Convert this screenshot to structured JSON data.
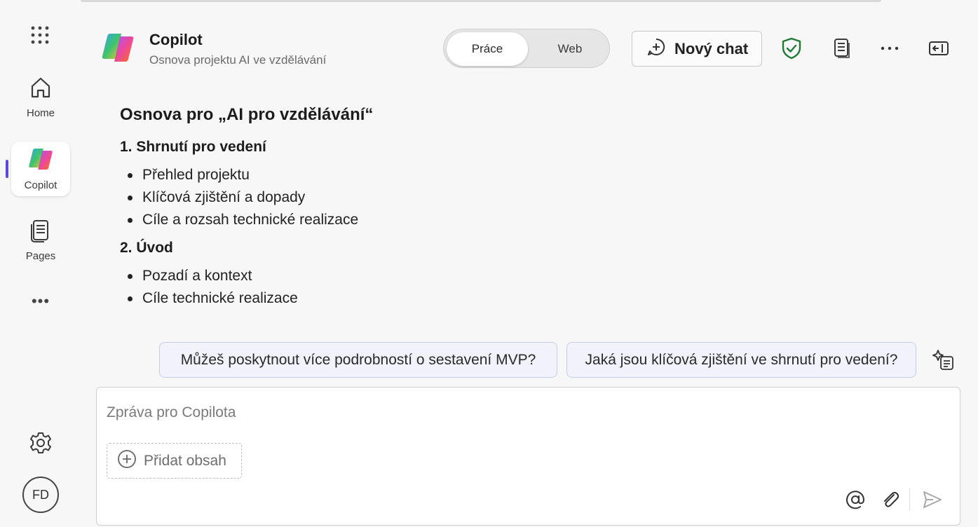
{
  "rail": {
    "items": [
      {
        "label": "Home"
      },
      {
        "label": "Copilot"
      },
      {
        "label": "Pages"
      }
    ],
    "avatar_initials": "FD"
  },
  "header": {
    "title": "Copilot",
    "subtitle": "Osnova projektu AI ve vzdělávání",
    "toggle": {
      "options": [
        "Práce",
        "Web"
      ],
      "selected": "Práce"
    },
    "new_chat_label": "Nový chat"
  },
  "content": {
    "heading": "Osnova pro „AI pro vzdělávání“",
    "sections": [
      {
        "title": "1. Shrnutí pro vedení",
        "items": [
          "Přehled projektu",
          "Klíčová zjištění a dopady",
          "Cíle a rozsah technické realizace"
        ]
      },
      {
        "title": "2. Úvod",
        "items": [
          "Pozadí a kontext",
          "Cíle technické realizace"
        ]
      }
    ]
  },
  "suggestions": [
    "Můžeš poskytnout více podrobností o sestavení MVP?",
    "Jaká jsou klíčová zjištění ve shrnutí pro vedení?"
  ],
  "composer": {
    "placeholder": "Zpráva pro Copilota",
    "add_content_label": "Přidat obsah"
  },
  "colors": {
    "accent": "#5b4bd6",
    "shield": "#1e7a36",
    "suggestion_border": "#c7cbe8"
  }
}
